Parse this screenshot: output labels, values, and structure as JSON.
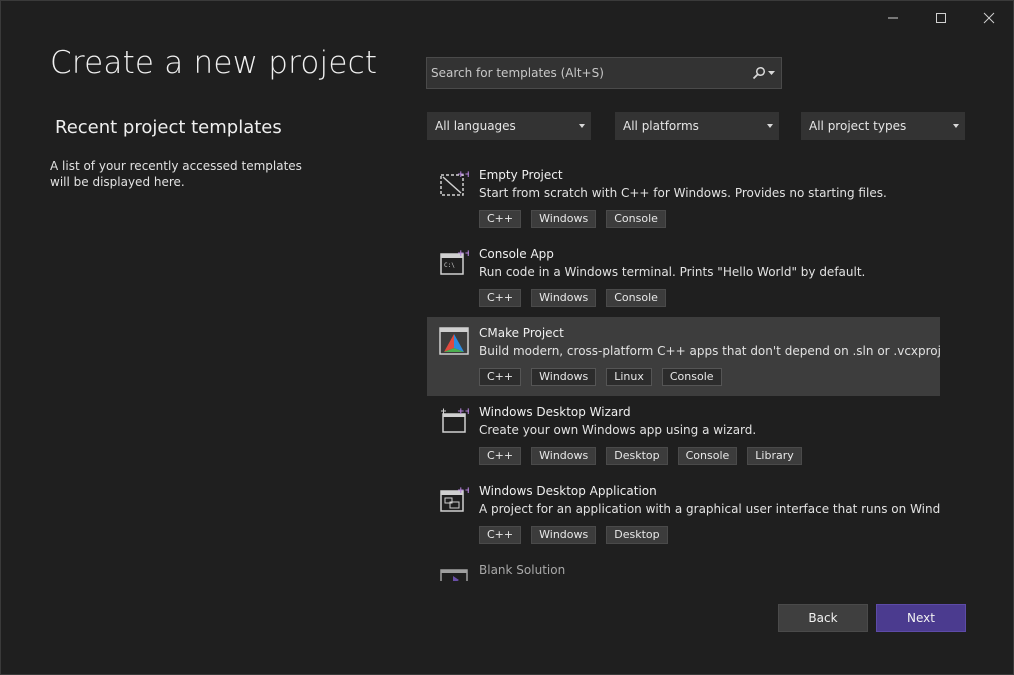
{
  "window": {
    "controls": [
      "minimize",
      "maximize",
      "close"
    ]
  },
  "page": {
    "title": "Create a new project"
  },
  "recent": {
    "heading": "Recent project templates",
    "description": "A list of your recently accessed templates will be displayed here."
  },
  "search": {
    "placeholder": "Search for templates (Alt+S)",
    "value": ""
  },
  "filters": {
    "language": "All languages",
    "platform": "All platforms",
    "project_type": "All project types"
  },
  "templates": [
    {
      "name": "Empty Project",
      "description": "Start from scratch with C++ for Windows. Provides no starting files.",
      "tags": [
        "C++",
        "Windows",
        "Console"
      ],
      "icon": "empty-project-icon",
      "selected": false
    },
    {
      "name": "Console App",
      "description": "Run code in a Windows terminal. Prints \"Hello World\" by default.",
      "tags": [
        "C++",
        "Windows",
        "Console"
      ],
      "icon": "console-app-icon",
      "selected": false
    },
    {
      "name": "CMake Project",
      "description": "Build modern, cross-platform C++ apps that don't depend on .sln or .vcxproj files.",
      "tags": [
        "C++",
        "Windows",
        "Linux",
        "Console"
      ],
      "icon": "cmake-icon",
      "selected": true
    },
    {
      "name": "Windows Desktop Wizard",
      "description": "Create your own Windows app using a wizard.",
      "tags": [
        "C++",
        "Windows",
        "Desktop",
        "Console",
        "Library"
      ],
      "icon": "desktop-wizard-icon",
      "selected": false
    },
    {
      "name": "Windows Desktop Application",
      "description": "A project for an application with a graphical user interface that runs on Windows.",
      "tags": [
        "C++",
        "Windows",
        "Desktop"
      ],
      "icon": "desktop-application-icon",
      "selected": false
    },
    {
      "name": "Blank Solution",
      "description": "",
      "tags": [],
      "icon": "blank-solution-icon",
      "selected": false
    }
  ],
  "buttons": {
    "back": "Back",
    "next": "Next"
  },
  "colors": {
    "background": "#1f1f1f",
    "selected_row": "#3d3d3d",
    "primary_button": "#4b3b8f",
    "accent_plus": "#b180d7"
  }
}
